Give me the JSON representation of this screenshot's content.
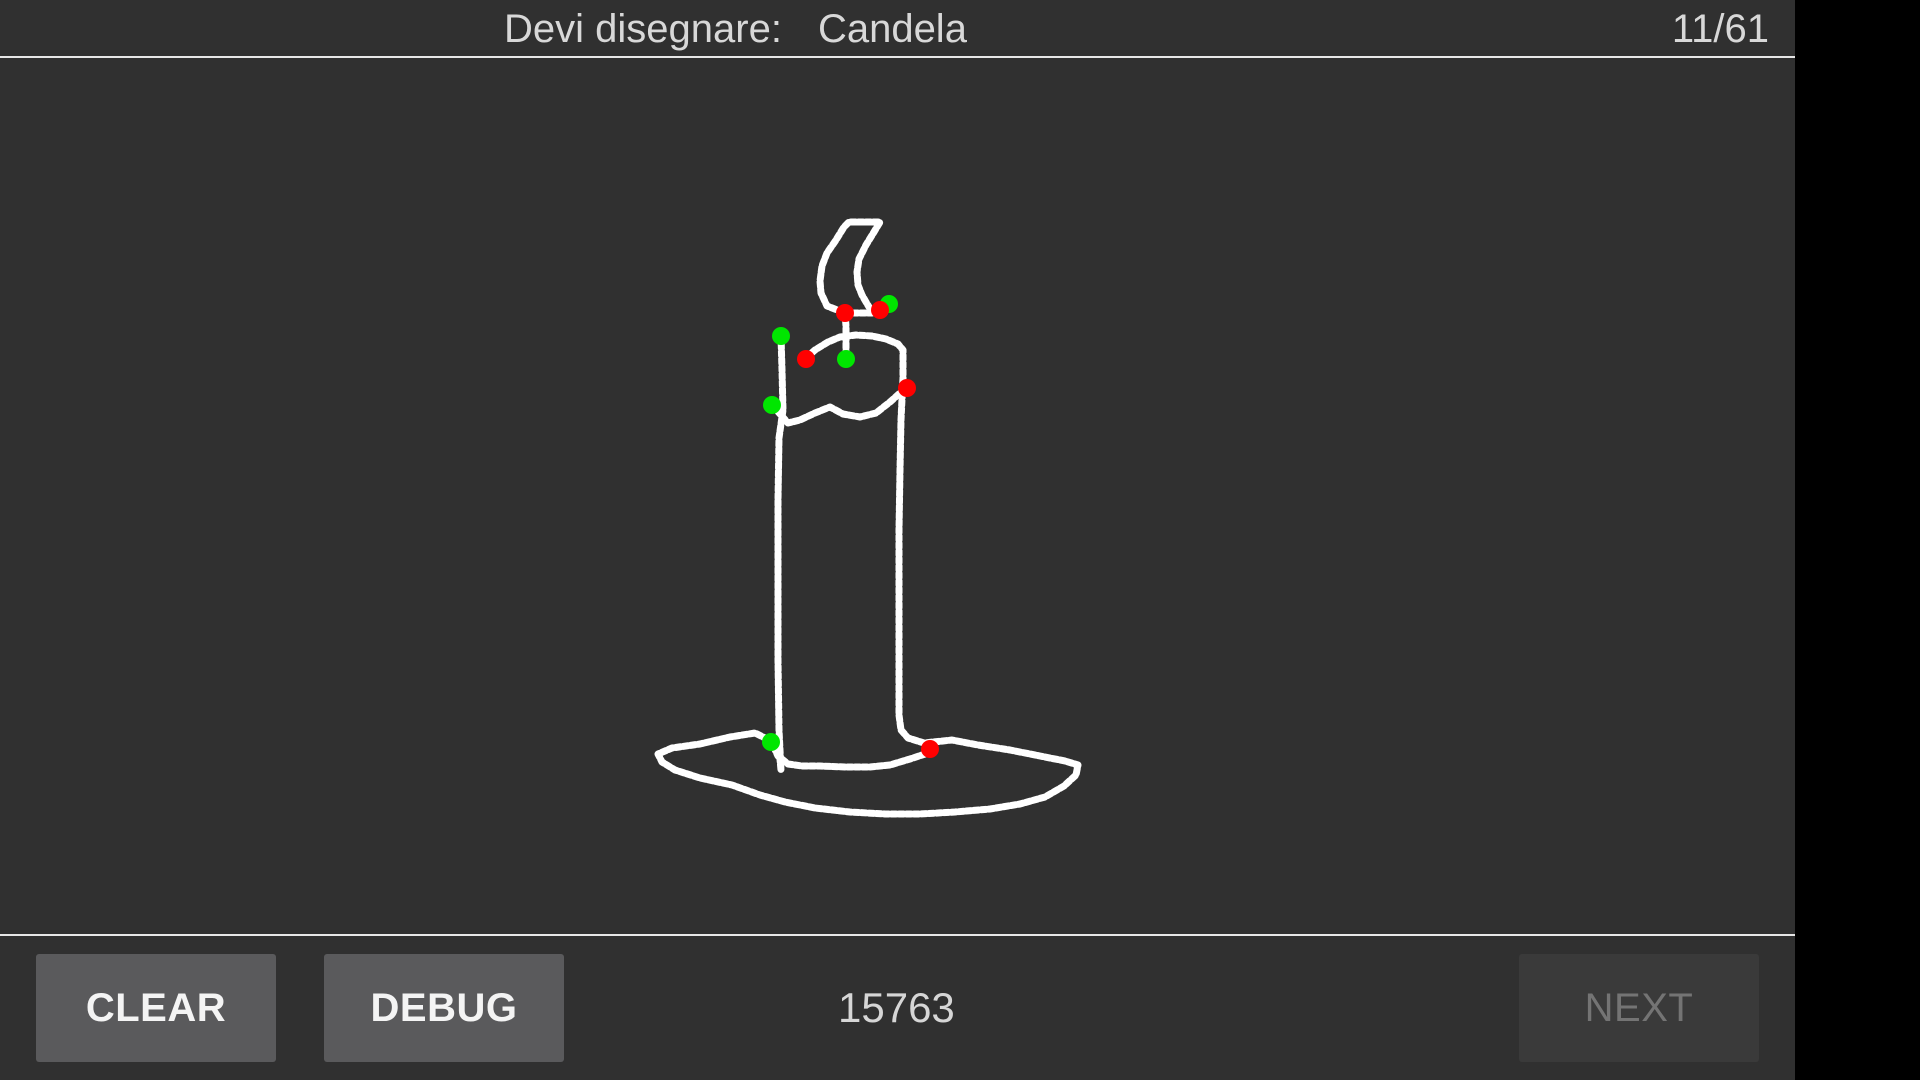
{
  "header": {
    "prompt_label": "Devi disegnare:",
    "prompt_word": "Candela",
    "progress": "11/61"
  },
  "drawing": {
    "subject": "candle",
    "stroke_color": "#ffffff",
    "start_marker_color": "#00e600",
    "end_marker_color": "#ff0000",
    "stroke_count": 7
  },
  "footer": {
    "clear_label": "CLEAR",
    "debug_label": "DEBUG",
    "score": "15763",
    "next_label": "NEXT",
    "next_enabled": false
  },
  "colors": {
    "background": "#303030",
    "button": "#5a5a5c",
    "button_disabled": "#3a3a3a",
    "text": "#d8d8d8"
  }
}
